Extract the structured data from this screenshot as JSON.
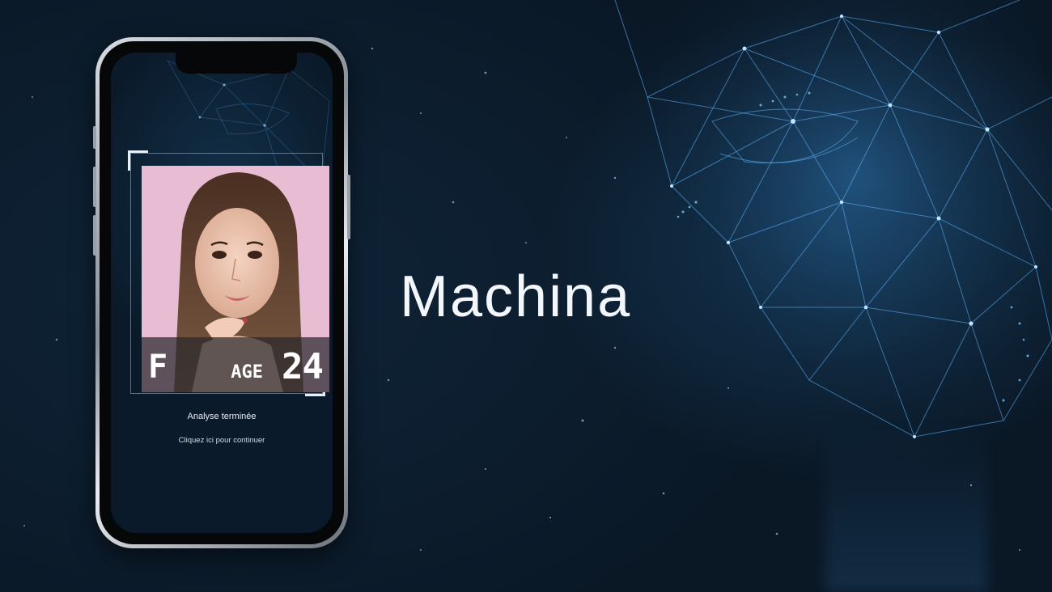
{
  "brand": {
    "title": "Machina"
  },
  "phone": {
    "result": {
      "gender": "F",
      "age_label": "AGE",
      "age_value": "24"
    },
    "status_text": "Analyse terminée",
    "continue_label": "Cliquez ici pour continuer"
  },
  "icons": [
    "face-mesh-illustration",
    "portrait-photo",
    "scan-frame-corner"
  ],
  "colors": {
    "background": "#0b1b2b",
    "mesh_glow": "#5fb6ff",
    "portrait_bg": "#e7b9cf",
    "text": "#f3f6fa"
  }
}
